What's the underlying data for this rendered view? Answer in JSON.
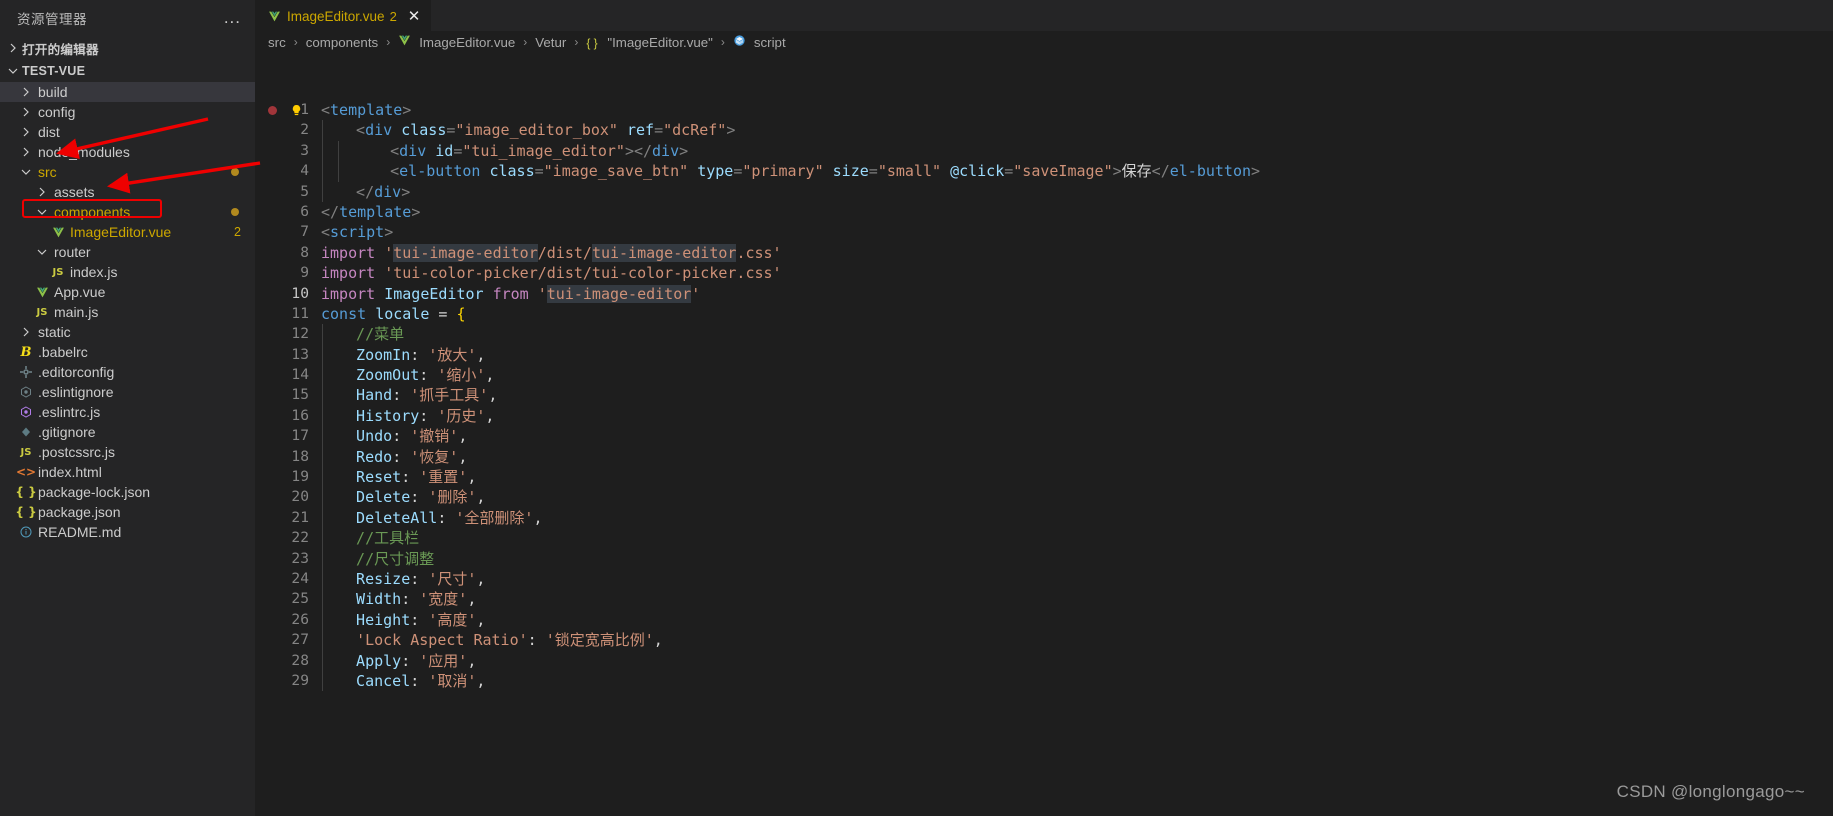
{
  "window": {
    "theme_bg": "#1e1e1e",
    "sidebar_bg": "#252526",
    "accent_highlight": "#ef0000"
  },
  "sidebar": {
    "title": "资源管理器",
    "more_actions_label": "...",
    "open_editors_label": "打开的编辑器",
    "project_label": "TEST-VUE",
    "items": [
      {
        "label": "build",
        "depth": 1,
        "kind": "folder",
        "icon": "chevron-right-icon",
        "selected": true,
        "badge": "",
        "dot": false
      },
      {
        "label": "config",
        "depth": 1,
        "kind": "folder",
        "icon": "chevron-right-icon",
        "selected": false,
        "badge": "",
        "dot": false
      },
      {
        "label": "dist",
        "depth": 1,
        "kind": "folder",
        "icon": "chevron-right-icon",
        "selected": false,
        "badge": "",
        "dot": false
      },
      {
        "label": "node_modules",
        "depth": 1,
        "kind": "folder",
        "icon": "chevron-right-icon",
        "selected": false,
        "badge": "",
        "dot": false
      },
      {
        "label": "src",
        "depth": 1,
        "kind": "folder-open",
        "icon": "chevron-down-icon",
        "selected": false,
        "badge": "",
        "dot": true
      },
      {
        "label": "assets",
        "depth": 2,
        "kind": "folder",
        "icon": "chevron-right-icon",
        "selected": false,
        "badge": "",
        "dot": false
      },
      {
        "label": "components",
        "depth": 2,
        "kind": "folder-open",
        "icon": "chevron-down-icon",
        "selected": false,
        "badge": "",
        "dot": true
      },
      {
        "label": "ImageEditor.vue",
        "depth": 3,
        "kind": "file",
        "icon": "vue-icon",
        "selected": false,
        "badge": "2",
        "dot": false
      },
      {
        "label": "router",
        "depth": 2,
        "kind": "folder-open",
        "icon": "chevron-down-icon",
        "selected": false,
        "badge": "",
        "dot": false
      },
      {
        "label": "index.js",
        "depth": 3,
        "kind": "file",
        "icon": "js-icon",
        "selected": false,
        "badge": "",
        "dot": false
      },
      {
        "label": "App.vue",
        "depth": 2,
        "kind": "file",
        "icon": "vue-icon",
        "selected": false,
        "badge": "",
        "dot": false
      },
      {
        "label": "main.js",
        "depth": 2,
        "kind": "file",
        "icon": "js-icon",
        "selected": false,
        "badge": "",
        "dot": false
      },
      {
        "label": "static",
        "depth": 1,
        "kind": "folder",
        "icon": "chevron-right-icon",
        "selected": false,
        "badge": "",
        "dot": false
      },
      {
        "label": ".babelrc",
        "depth": 1,
        "kind": "file",
        "icon": "babel-icon",
        "selected": false,
        "badge": "",
        "dot": false
      },
      {
        "label": ".editorconfig",
        "depth": 1,
        "kind": "file",
        "icon": "gear-icon",
        "selected": false,
        "badge": "",
        "dot": false
      },
      {
        "label": ".eslintignore",
        "depth": 1,
        "kind": "file",
        "icon": "eslint-grey-icon",
        "selected": false,
        "badge": "",
        "dot": false
      },
      {
        "label": ".eslintrc.js",
        "depth": 1,
        "kind": "file",
        "icon": "eslint-purple-icon",
        "selected": false,
        "badge": "",
        "dot": false
      },
      {
        "label": ".gitignore",
        "depth": 1,
        "kind": "file",
        "icon": "git-icon",
        "selected": false,
        "badge": "",
        "dot": false
      },
      {
        "label": ".postcssrc.js",
        "depth": 1,
        "kind": "file",
        "icon": "js-icon",
        "selected": false,
        "badge": "",
        "dot": false
      },
      {
        "label": "index.html",
        "depth": 1,
        "kind": "file",
        "icon": "html-icon",
        "selected": false,
        "badge": "",
        "dot": false
      },
      {
        "label": "package-lock.json",
        "depth": 1,
        "kind": "file",
        "icon": "json-icon",
        "selected": false,
        "badge": "",
        "dot": false
      },
      {
        "label": "package.json",
        "depth": 1,
        "kind": "file",
        "icon": "json-icon",
        "selected": false,
        "badge": "",
        "dot": false
      },
      {
        "label": "README.md",
        "depth": 1,
        "kind": "file",
        "icon": "info-icon",
        "selected": false,
        "badge": "",
        "dot": false
      }
    ]
  },
  "tab": {
    "icon": "vue-icon",
    "name": "ImageEditor.vue",
    "problem_count": "2",
    "close_label": "✕"
  },
  "breadcrumb": [
    {
      "label": "src",
      "icon": ""
    },
    {
      "label": "components",
      "icon": ""
    },
    {
      "label": "ImageEditor.vue",
      "icon": "vue-icon"
    },
    {
      "label": "Vetur",
      "icon": ""
    },
    {
      "label": "\"ImageEditor.vue\"",
      "icon": "json-icon"
    },
    {
      "label": "script",
      "icon": "symbol-module-icon"
    }
  ],
  "breadcrumb_separator": "›",
  "editor": {
    "first_line": 1,
    "lines": [
      {
        "n": "1",
        "glyph": "",
        "indent": 0,
        "tokens": [
          {
            "t": "<",
            "c": "t-punct"
          },
          {
            "t": "template",
            "c": "t-tag"
          },
          {
            "t": ">",
            "c": "t-punct"
          }
        ]
      },
      {
        "n": "2",
        "glyph": "",
        "indent": 1,
        "tokens": [
          {
            "t": "  <",
            "c": "t-punct"
          },
          {
            "t": "div",
            "c": "t-tag"
          },
          {
            "t": " ",
            "c": "t-plain"
          },
          {
            "t": "class",
            "c": "t-attr"
          },
          {
            "t": "=",
            "c": "t-punct"
          },
          {
            "t": "\"image_editor_box\"",
            "c": "t-str"
          },
          {
            "t": " ",
            "c": "t-plain"
          },
          {
            "t": "ref",
            "c": "t-attr"
          },
          {
            "t": "=",
            "c": "t-punct"
          },
          {
            "t": "\"dcRef\"",
            "c": "t-str"
          },
          {
            "t": ">",
            "c": "t-punct"
          }
        ]
      },
      {
        "n": "3",
        "glyph": "",
        "indent": 2,
        "tokens": [
          {
            "t": "    <",
            "c": "t-punct"
          },
          {
            "t": "div",
            "c": "t-tag"
          },
          {
            "t": " ",
            "c": "t-plain"
          },
          {
            "t": "id",
            "c": "t-attr"
          },
          {
            "t": "=",
            "c": "t-punct"
          },
          {
            "t": "\"tui_image_editor\"",
            "c": "t-str"
          },
          {
            "t": ">",
            "c": "t-punct"
          },
          {
            "t": "</",
            "c": "t-punct"
          },
          {
            "t": "div",
            "c": "t-tag"
          },
          {
            "t": ">",
            "c": "t-punct"
          }
        ]
      },
      {
        "n": "4",
        "glyph": "",
        "indent": 2,
        "tokens": [
          {
            "t": "    <",
            "c": "t-punct"
          },
          {
            "t": "el-button",
            "c": "t-tag"
          },
          {
            "t": " ",
            "c": "t-plain"
          },
          {
            "t": "class",
            "c": "t-attr"
          },
          {
            "t": "=",
            "c": "t-punct"
          },
          {
            "t": "\"image_save_btn\"",
            "c": "t-str"
          },
          {
            "t": " ",
            "c": "t-plain"
          },
          {
            "t": "type",
            "c": "t-attr"
          },
          {
            "t": "=",
            "c": "t-punct"
          },
          {
            "t": "\"primary\"",
            "c": "t-str"
          },
          {
            "t": " ",
            "c": "t-plain"
          },
          {
            "t": "size",
            "c": "t-attr"
          },
          {
            "t": "=",
            "c": "t-punct"
          },
          {
            "t": "\"small\"",
            "c": "t-str"
          },
          {
            "t": " ",
            "c": "t-plain"
          },
          {
            "t": "@click",
            "c": "t-attr"
          },
          {
            "t": "=",
            "c": "t-punct"
          },
          {
            "t": "\"saveImage\"",
            "c": "t-str"
          },
          {
            "t": ">",
            "c": "t-punct"
          },
          {
            "t": "保存",
            "c": "t-plain"
          },
          {
            "t": "</",
            "c": "t-punct"
          },
          {
            "t": "el-button",
            "c": "t-tag"
          },
          {
            "t": ">",
            "c": "t-punct"
          }
        ]
      },
      {
        "n": "5",
        "glyph": "",
        "indent": 1,
        "tokens": [
          {
            "t": "  </",
            "c": "t-punct"
          },
          {
            "t": "div",
            "c": "t-tag"
          },
          {
            "t": ">",
            "c": "t-punct"
          }
        ]
      },
      {
        "n": "6",
        "glyph": "",
        "indent": 0,
        "tokens": [
          {
            "t": "</",
            "c": "t-punct"
          },
          {
            "t": "template",
            "c": "t-tag"
          },
          {
            "t": ">",
            "c": "t-punct"
          }
        ]
      },
      {
        "n": "7",
        "glyph": "",
        "indent": 0,
        "tokens": [
          {
            "t": "<",
            "c": "t-punct"
          },
          {
            "t": "script",
            "c": "t-tag"
          },
          {
            "t": ">",
            "c": "t-punct"
          }
        ]
      },
      {
        "n": "8",
        "glyph": "",
        "indent": 0,
        "tokens": [
          {
            "t": "import ",
            "c": "t-kw"
          },
          {
            "t": "'",
            "c": "t-str"
          },
          {
            "t": "tui-image-editor",
            "c": "t-str t-hl"
          },
          {
            "t": "/dist/",
            "c": "t-str"
          },
          {
            "t": "tui-image-editor",
            "c": "t-str t-hl"
          },
          {
            "t": ".css'",
            "c": "t-str"
          }
        ]
      },
      {
        "n": "9",
        "glyph": "bulb",
        "indent": 0,
        "tokens": [
          {
            "t": "import ",
            "c": "t-kw"
          },
          {
            "t": "'tui-color-picker/dist/tui-color-picker.css'",
            "c": "t-str"
          }
        ]
      },
      {
        "n": "10",
        "glyph": "",
        "indent": 0,
        "tokens": [
          {
            "t": "import ",
            "c": "t-kw"
          },
          {
            "t": "ImageEditor",
            "c": "t-id"
          },
          {
            "t": " from ",
            "c": "t-kw"
          },
          {
            "t": "'",
            "c": "t-str"
          },
          {
            "t": "tui-image-editor",
            "c": "t-str t-hl"
          },
          {
            "t": "'",
            "c": "t-str"
          }
        ]
      },
      {
        "n": "11",
        "glyph": "breakpoint",
        "indent": 0,
        "tokens": [
          {
            "t": "const ",
            "c": "t-kw2"
          },
          {
            "t": "locale",
            "c": "t-id"
          },
          {
            "t": " = ",
            "c": "t-plain"
          },
          {
            "t": "{",
            "c": "t-brace"
          }
        ]
      },
      {
        "n": "12",
        "glyph": "",
        "indent": 1,
        "tokens": [
          {
            "t": "  //菜单",
            "c": "t-comment"
          }
        ]
      },
      {
        "n": "13",
        "glyph": "",
        "indent": 1,
        "tokens": [
          {
            "t": "  ZoomIn",
            "c": "t-prop"
          },
          {
            "t": ": ",
            "c": "t-plain"
          },
          {
            "t": "'放大'",
            "c": "t-str"
          },
          {
            "t": ",",
            "c": "t-plain"
          }
        ]
      },
      {
        "n": "14",
        "glyph": "",
        "indent": 1,
        "tokens": [
          {
            "t": "  ZoomOut",
            "c": "t-prop"
          },
          {
            "t": ": ",
            "c": "t-plain"
          },
          {
            "t": "'缩小'",
            "c": "t-str"
          },
          {
            "t": ",",
            "c": "t-plain"
          }
        ]
      },
      {
        "n": "15",
        "glyph": "",
        "indent": 1,
        "tokens": [
          {
            "t": "  Hand",
            "c": "t-prop"
          },
          {
            "t": ": ",
            "c": "t-plain"
          },
          {
            "t": "'抓手工具'",
            "c": "t-str"
          },
          {
            "t": ",",
            "c": "t-plain"
          }
        ]
      },
      {
        "n": "16",
        "glyph": "",
        "indent": 1,
        "tokens": [
          {
            "t": "  History",
            "c": "t-prop"
          },
          {
            "t": ": ",
            "c": "t-plain"
          },
          {
            "t": "'历史'",
            "c": "t-str"
          },
          {
            "t": ",",
            "c": "t-plain"
          }
        ]
      },
      {
        "n": "17",
        "glyph": "",
        "indent": 1,
        "tokens": [
          {
            "t": "  Undo",
            "c": "t-prop"
          },
          {
            "t": ": ",
            "c": "t-plain"
          },
          {
            "t": "'撤销'",
            "c": "t-str"
          },
          {
            "t": ",",
            "c": "t-plain"
          }
        ]
      },
      {
        "n": "18",
        "glyph": "",
        "indent": 1,
        "tokens": [
          {
            "t": "  Redo",
            "c": "t-prop"
          },
          {
            "t": ": ",
            "c": "t-plain"
          },
          {
            "t": "'恢复'",
            "c": "t-str"
          },
          {
            "t": ",",
            "c": "t-plain"
          }
        ]
      },
      {
        "n": "19",
        "glyph": "",
        "indent": 1,
        "tokens": [
          {
            "t": "  Reset",
            "c": "t-prop"
          },
          {
            "t": ": ",
            "c": "t-plain"
          },
          {
            "t": "'重置'",
            "c": "t-str"
          },
          {
            "t": ",",
            "c": "t-plain"
          }
        ]
      },
      {
        "n": "20",
        "glyph": "",
        "indent": 1,
        "tokens": [
          {
            "t": "  Delete",
            "c": "t-prop"
          },
          {
            "t": ": ",
            "c": "t-plain"
          },
          {
            "t": "'删除'",
            "c": "t-str"
          },
          {
            "t": ",",
            "c": "t-plain"
          }
        ]
      },
      {
        "n": "21",
        "glyph": "",
        "indent": 1,
        "tokens": [
          {
            "t": "  DeleteAll",
            "c": "t-prop"
          },
          {
            "t": ": ",
            "c": "t-plain"
          },
          {
            "t": "'全部删除'",
            "c": "t-str"
          },
          {
            "t": ",",
            "c": "t-plain"
          }
        ]
      },
      {
        "n": "22",
        "glyph": "",
        "indent": 1,
        "tokens": [
          {
            "t": "  //工具栏",
            "c": "t-comment"
          }
        ]
      },
      {
        "n": "23",
        "glyph": "",
        "indent": 1,
        "tokens": [
          {
            "t": "  //尺寸调整",
            "c": "t-comment"
          }
        ]
      },
      {
        "n": "24",
        "glyph": "",
        "indent": 1,
        "tokens": [
          {
            "t": "  Resize",
            "c": "t-prop"
          },
          {
            "t": ": ",
            "c": "t-plain"
          },
          {
            "t": "'尺寸'",
            "c": "t-str"
          },
          {
            "t": ",",
            "c": "t-plain"
          }
        ]
      },
      {
        "n": "25",
        "glyph": "",
        "indent": 1,
        "tokens": [
          {
            "t": "  Width",
            "c": "t-prop"
          },
          {
            "t": ": ",
            "c": "t-plain"
          },
          {
            "t": "'宽度'",
            "c": "t-str"
          },
          {
            "t": ",",
            "c": "t-plain"
          }
        ]
      },
      {
        "n": "26",
        "glyph": "",
        "indent": 1,
        "tokens": [
          {
            "t": "  Height",
            "c": "t-prop"
          },
          {
            "t": ": ",
            "c": "t-plain"
          },
          {
            "t": "'高度'",
            "c": "t-str"
          },
          {
            "t": ",",
            "c": "t-plain"
          }
        ]
      },
      {
        "n": "27",
        "glyph": "",
        "indent": 1,
        "tokens": [
          {
            "t": "  ",
            "c": "t-plain"
          },
          {
            "t": "'Lock Aspect Ratio'",
            "c": "t-str"
          },
          {
            "t": ": ",
            "c": "t-plain"
          },
          {
            "t": "'锁定宽高比例'",
            "c": "t-str"
          },
          {
            "t": ",",
            "c": "t-plain"
          }
        ]
      },
      {
        "n": "28",
        "glyph": "",
        "indent": 1,
        "tokens": [
          {
            "t": "  Apply",
            "c": "t-prop"
          },
          {
            "t": ": ",
            "c": "t-plain"
          },
          {
            "t": "'应用'",
            "c": "t-str"
          },
          {
            "t": ",",
            "c": "t-plain"
          }
        ]
      },
      {
        "n": "29",
        "glyph": "",
        "indent": 1,
        "tokens": [
          {
            "t": "  Cancel",
            "c": "t-prop"
          },
          {
            "t": ": ",
            "c": "t-plain"
          },
          {
            "t": "'取消'",
            "c": "t-str"
          },
          {
            "t": ",",
            "c": "t-plain"
          }
        ]
      }
    ]
  },
  "watermark": "CSDN @longlongago~~"
}
